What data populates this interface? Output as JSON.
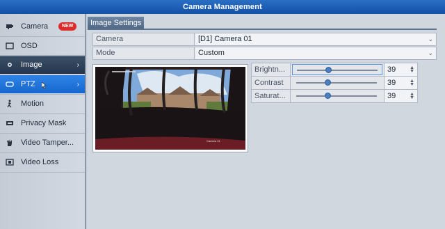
{
  "window": {
    "title": "Camera Management"
  },
  "sidebar": {
    "items": [
      {
        "label": "Camera",
        "icon": "camera-icon",
        "badge": "NEW"
      },
      {
        "label": "OSD",
        "icon": "osd-icon"
      },
      {
        "label": "Image",
        "icon": "image-icon",
        "state": "selected"
      },
      {
        "label": "PTZ",
        "icon": "ptz-icon",
        "state": "hovered"
      },
      {
        "label": "Motion",
        "icon": "motion-icon"
      },
      {
        "label": "Privacy Mask",
        "icon": "privacy-mask-icon"
      },
      {
        "label": "Video Tamper...",
        "icon": "video-tamper-icon"
      },
      {
        "label": "Video Loss",
        "icon": "video-loss-icon"
      }
    ]
  },
  "main": {
    "tab_label": "Image Settings",
    "camera": {
      "label": "Camera",
      "value": "[D1] Camera 01"
    },
    "mode": {
      "label": "Mode",
      "value": "Custom"
    },
    "preview": {
      "camera_name": "Camera 01"
    },
    "adjustments": [
      {
        "label": "Brightn...",
        "value": "39",
        "level": 0.39
      },
      {
        "label": "Contrast",
        "value": "39",
        "level": 0.39
      },
      {
        "label": "Saturat...",
        "value": "39",
        "level": 0.39
      }
    ]
  },
  "colors": {
    "title_bar": "#1e5fb8",
    "selected_item": "#2f4560",
    "hover_item": "#1f74dc",
    "badge": "#e02b2b"
  }
}
